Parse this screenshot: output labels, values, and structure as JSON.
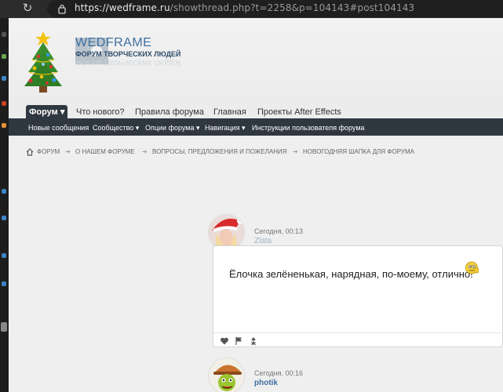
{
  "browser": {
    "url_host": "https://wedframe.ru",
    "url_path": "/showthread.php?t=2258&p=104143#post104143"
  },
  "header": {
    "brand": "WEDFRAME",
    "subtitle": "ФОРУМ ТВОРЧЕСКИХ ЛЮДЕЙ"
  },
  "nav": {
    "tabs": [
      "Форум",
      "Что нового?",
      "Правила форума",
      "Главная",
      "Проекты After Effects"
    ],
    "subnav": [
      "Новые сообщения",
      "Сообщество",
      "Опции форума",
      "Навигация",
      "Инструкции пользователя форума"
    ]
  },
  "breadcrumb": [
    "ФОРУМ",
    "О НАШЕМ ФОРУМЕ",
    "ВОПРОСЫ, ПРЕДЛОЖЕНИЯ И ПОЖЕЛАНИЯ",
    "НОВОГОДНЯЯ ШАПКА ДЛЯ ФОРУМА"
  ],
  "posts": [
    {
      "date": "Сегодня, 00:13",
      "user": "Zlata",
      "text": "Ёлочка зелёненькая, нарядная, по-моему, отлично!"
    },
    {
      "date": "Сегодня, 00:16",
      "user": "photik"
    }
  ],
  "colors": {
    "nav_dark": "#2f3740",
    "brand_blue": "#3d6fa1",
    "user_blue": "#3d6fa1",
    "user_muted": "#9fb3c8"
  }
}
